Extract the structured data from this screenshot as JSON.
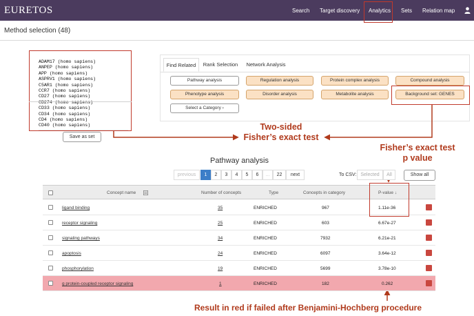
{
  "app": {
    "logo": "EURETOS",
    "nav": [
      {
        "label": "Search"
      },
      {
        "label": "Target discovery"
      },
      {
        "label": "Analytics"
      },
      {
        "label": "Sets"
      },
      {
        "label": "Relation map"
      }
    ],
    "user_icon": "user-icon"
  },
  "method_selection": "Method selection (48)",
  "concept_list": [
    "ADAM17 (homo sapiens)",
    "ANPEP (homo sapiens)",
    "APP (homo sapiens)",
    "ASPRV1 (homo sapiens)",
    "C5AR1 (homo sapiens)",
    "CCR7 (homo sapiens)",
    "CD27 (homo sapiens)",
    "CD274 (homo sapiens)",
    "CD33 (homo sapiens)",
    "CD34 (homo sapiens)",
    "CD4 (homo sapiens)",
    "CD40 (homo sapiens)"
  ],
  "save_as_set": "Save as set",
  "tabs": [
    {
      "label": "Find Related",
      "active": true
    },
    {
      "label": "Rank Selection",
      "active": false
    },
    {
      "label": "Network Analysis",
      "active": false
    }
  ],
  "analysis_buttons": {
    "row1": [
      "Pathway analysis",
      "Regulation analysis",
      "Protein complex analysis",
      "Compound analysis"
    ],
    "row2": [
      "Phenotype analysis",
      "Disorder analysis",
      "Metabolite analysis",
      "Background set: GENES"
    ],
    "row3": [
      "Select a Category ›"
    ]
  },
  "annotations": {
    "two_sided_line1": "Two-sided",
    "two_sided_line2": "Fisher’s exact test",
    "pvalue_line1": "Fisher’s exact test",
    "pvalue_line2": "p value",
    "red_note": "Result in red if failed after Benjamini-Hochberg procedure"
  },
  "results": {
    "title": "Pathway analysis",
    "pager": [
      "previous",
      "1",
      "2",
      "3",
      "4",
      "5",
      "6",
      "...",
      "22",
      "next"
    ],
    "to_csv": "To CSV:",
    "csv_selected": "Selected",
    "csv_all": "All",
    "show_all": "Show all",
    "columns": [
      "Concept name",
      "Number of concepts",
      "Type",
      "Concepts in category",
      "P-value ↓"
    ],
    "rows": [
      {
        "name": "ligand binding",
        "count": "35",
        "type": "ENRICHED",
        "in_category": "967",
        "pvalue": "1.11e-36",
        "failed": false
      },
      {
        "name": "receptor signaling",
        "count": "25",
        "type": "ENRICHED",
        "in_category": "603",
        "pvalue": "6.67e-27",
        "failed": false
      },
      {
        "name": "signaling pathways",
        "count": "34",
        "type": "ENRICHED",
        "in_category": "7932",
        "pvalue": "6.21e-21",
        "failed": false
      },
      {
        "name": "apoptosis",
        "count": "24",
        "type": "ENRICHED",
        "in_category": "6097",
        "pvalue": "3.64e-12",
        "failed": false
      },
      {
        "name": "phosphorylation",
        "count": "19",
        "type": "ENRICHED",
        "in_category": "5699",
        "pvalue": "3.78e-10",
        "failed": false
      },
      {
        "name": "g protein-coupled receptor signaling",
        "count": "1",
        "type": "ENRICHED",
        "in_category": "182",
        "pvalue": "0.262",
        "failed": true
      }
    ]
  },
  "colors": {
    "nav_bg": "#4b3b5e",
    "annotation": "#b03a1c",
    "highlight_border": "#c0392b",
    "failed_row": "#f2a8ae",
    "analysis_button": "#fbe1c4",
    "pager_active": "#3c7ec8"
  }
}
